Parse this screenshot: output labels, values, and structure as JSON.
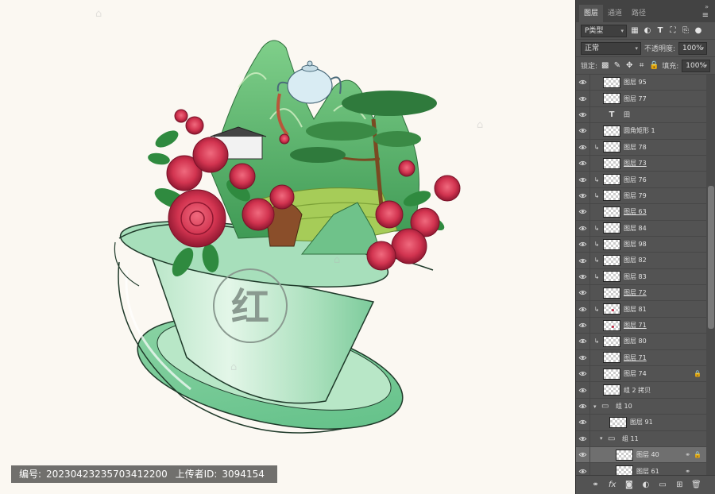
{
  "credit": {
    "id_label": "编号:",
    "id_value": "20230423235703412200",
    "uploader_label": "上传者ID:",
    "uploader_value": "3094154"
  },
  "artwork": {
    "seal_character": "红",
    "colors": {
      "cup_light": "#c9ecd4",
      "cup_mid": "#9fdcb5",
      "cup_dark": "#6fc491",
      "rose": "#d8334f",
      "rose_dark": "#9c1a33",
      "leaf": "#2f8a3f",
      "mountain": "#5fb872",
      "tea_field": "#a6cc58"
    }
  },
  "panel": {
    "tabs": [
      "图层",
      "通道",
      "路径"
    ],
    "active_tab": 0,
    "filter_label": "P类型",
    "blend_mode": "正常",
    "opacity_label": "不透明度:",
    "opacity_value": "100%",
    "lock_label": "锁定:",
    "fill_label": "填充:",
    "fill_value": "100%",
    "layers": [
      {
        "name": "图层 95",
        "type": "pixel",
        "clip": false,
        "indent": 0,
        "underline": false
      },
      {
        "name": "图层 77",
        "type": "pixel",
        "clip": false,
        "indent": 0,
        "underline": false
      },
      {
        "name": "田",
        "type": "text",
        "clip": false,
        "indent": 0,
        "underline": false
      },
      {
        "name": "圆角矩形 1",
        "type": "shape",
        "clip": false,
        "indent": 0,
        "underline": false
      },
      {
        "name": "图层 78",
        "type": "pixel",
        "clip": true,
        "indent": 0,
        "underline": false
      },
      {
        "name": "图层 73",
        "type": "pixel",
        "clip": false,
        "indent": 0,
        "underline": true
      },
      {
        "name": "图层 76",
        "type": "pixel",
        "clip": true,
        "indent": 0,
        "underline": false
      },
      {
        "name": "图层 79",
        "type": "pixel",
        "clip": true,
        "indent": 0,
        "underline": false
      },
      {
        "name": "图层 63",
        "type": "pixel",
        "clip": false,
        "indent": 0,
        "underline": true
      },
      {
        "name": "图层 84",
        "type": "pixel",
        "clip": true,
        "indent": 0,
        "underline": false
      },
      {
        "name": "图层 98",
        "type": "pixel",
        "clip": true,
        "indent": 0,
        "underline": false
      },
      {
        "name": "图层 82",
        "type": "pixel",
        "clip": true,
        "indent": 0,
        "underline": false
      },
      {
        "name": "图层 83",
        "type": "pixel",
        "clip": true,
        "indent": 0,
        "underline": false
      },
      {
        "name": "图层 72",
        "type": "pixel",
        "clip": false,
        "indent": 0,
        "underline": true
      },
      {
        "name": "图层 81",
        "type": "pixel",
        "clip": true,
        "indent": 0,
        "underline": false,
        "dot": true
      },
      {
        "name": "图层 71",
        "type": "pixel",
        "clip": false,
        "indent": 0,
        "underline": true,
        "dot": true
      },
      {
        "name": "图层 80",
        "type": "pixel",
        "clip": true,
        "indent": 0,
        "underline": false
      },
      {
        "name": "图层 71",
        "type": "pixel",
        "clip": false,
        "indent": 0,
        "underline": true
      },
      {
        "name": "图层 74",
        "type": "pixel",
        "clip": false,
        "indent": 0,
        "underline": false,
        "flag": "🔒"
      },
      {
        "name": "组 2 拷贝",
        "type": "shape",
        "clip": false,
        "indent": 0,
        "underline": false
      },
      {
        "name": "组 10",
        "type": "group",
        "clip": false,
        "indent": 0,
        "underline": false
      },
      {
        "name": "图层 91",
        "type": "pixel",
        "clip": false,
        "indent": 1,
        "underline": false
      },
      {
        "name": "组 11",
        "type": "group",
        "clip": false,
        "indent": 1,
        "underline": false
      },
      {
        "name": "图层 40",
        "type": "pixel",
        "clip": false,
        "indent": 2,
        "underline": false,
        "selected": true,
        "flag": "🔒",
        "flag2": "⚭"
      },
      {
        "name": "图层 61",
        "type": "pixel",
        "clip": false,
        "indent": 2,
        "underline": false,
        "flag2": "⚭"
      }
    ],
    "footer_icons": [
      "link-icon",
      "fx-icon",
      "mask-icon",
      "adjustment-icon",
      "folder-icon",
      "new-layer-icon",
      "trash-icon"
    ]
  }
}
